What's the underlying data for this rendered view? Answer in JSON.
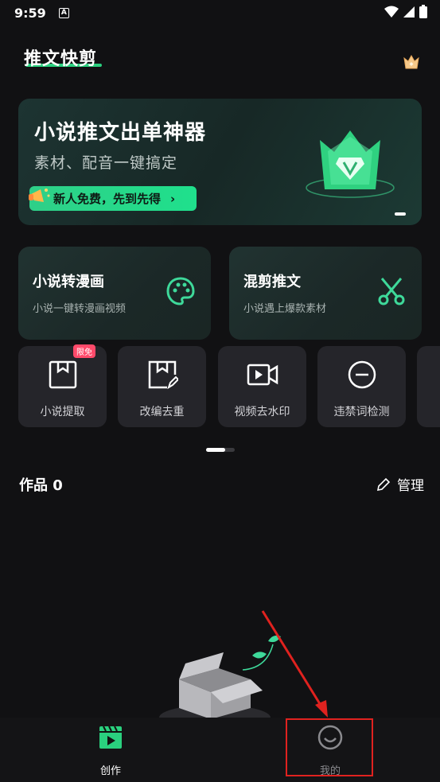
{
  "status_bar": {
    "time": "9:59",
    "notification_glyph": "A"
  },
  "header": {
    "title": "推文快剪",
    "crown_icon": "crown-icon"
  },
  "banner": {
    "title": "小说推文出单神器",
    "subtitle": "素材、配音一键搞定",
    "cta_label": "新人免费，先到先得",
    "cta_chevron": "›"
  },
  "features": [
    {
      "title": "小说转漫画",
      "subtitle": "小说一键转漫画视频",
      "icon": "palette-icon"
    },
    {
      "title": "混剪推文",
      "subtitle": "小说遇上爆款素材",
      "icon": "scissors-icon"
    }
  ],
  "tools": [
    {
      "label": "小说提取",
      "badge": "限免",
      "icon": "bookmark-icon"
    },
    {
      "label": "改编去重",
      "icon": "edit-bookmark-icon"
    },
    {
      "label": "视频去水印",
      "icon": "video-camera-icon"
    },
    {
      "label": "违禁词检测",
      "icon": "minus-circle-icon"
    }
  ],
  "works": {
    "title": "作品 0",
    "manage_label": "管理"
  },
  "tab_bar": {
    "tabs": [
      {
        "label": "创作",
        "icon": "clapperboard-icon",
        "active": true
      },
      {
        "label": "我的",
        "icon": "smile-icon",
        "active": false
      }
    ]
  },
  "colors": {
    "accent": "#2ad07e",
    "annotation": "#e0221f"
  }
}
